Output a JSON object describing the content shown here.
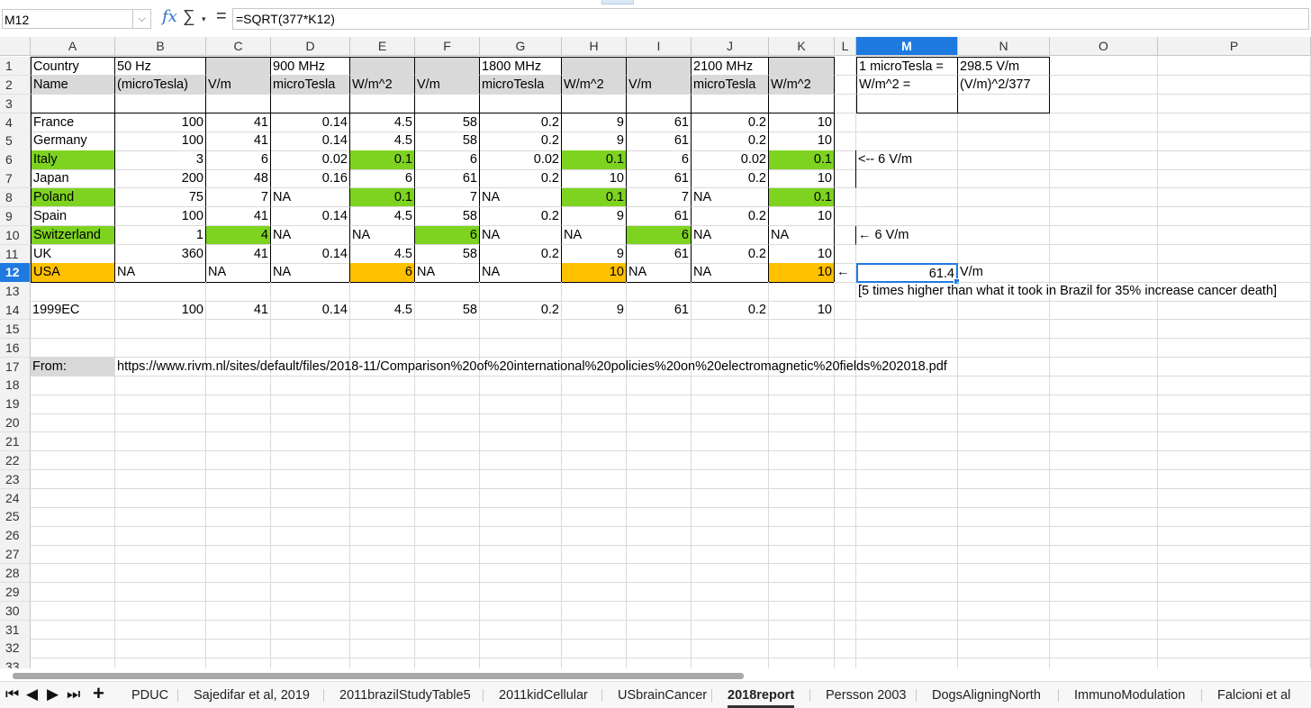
{
  "formula_bar": {
    "name_box": "M12",
    "name_box_dropdown": "⌵",
    "fx_icon": "fx",
    "sigma_icon": "∑",
    "sigma_drop": "▾",
    "equals_icon": "=",
    "formula": "=SQRT(377*K12)"
  },
  "columns": [
    "A",
    "B",
    "C",
    "D",
    "E",
    "F",
    "G",
    "H",
    "I",
    "J",
    "K",
    "L",
    "M",
    "N",
    "O",
    "P"
  ],
  "selected_column": "M",
  "selected_row": "12",
  "rows": [
    "1",
    "2",
    "3",
    "4",
    "5",
    "6",
    "7",
    "8",
    "9",
    "10",
    "11",
    "12",
    "13",
    "14",
    "15",
    "16",
    "17",
    "18",
    "19",
    "20",
    "21",
    "22",
    "23",
    "24",
    "25",
    "26",
    "27",
    "28",
    "29",
    "30",
    "31",
    "32",
    "33"
  ],
  "cells": {
    "A1": "Country",
    "B1": "50 Hz",
    "D1": "900 MHz",
    "G1": "1800 MHz",
    "J1": "2100 MHz",
    "M1": "1 microTesla =",
    "N1": "298.5 V/m",
    "A2": "Name",
    "B2": "(microTesla)",
    "C2": "V/m",
    "D2": "microTesla",
    "E2": "W/m^2",
    "F2": "V/m",
    "G2": "microTesla",
    "H2": "W/m^2",
    "I2": "V/m",
    "J2": "microTesla",
    "K2": "W/m^2",
    "M2": "W/m^2 =",
    "N2": "(V/m)^2/377",
    "A4": "France",
    "B4": "100",
    "C4": "41",
    "D4": "0.14",
    "E4": "4.5",
    "F4": "58",
    "G4": "0.2",
    "H4": "9",
    "I4": "61",
    "J4": "0.2",
    "K4": "10",
    "A5": "Germany",
    "B5": "100",
    "C5": "41",
    "D5": "0.14",
    "E5": "4.5",
    "F5": "58",
    "G5": "0.2",
    "H5": "9",
    "I5": "61",
    "J5": "0.2",
    "K5": "10",
    "A6": "Italy",
    "B6": "3",
    "C6": "6",
    "D6": "0.02",
    "E6": "0.1",
    "F6": "6",
    "G6": "0.02",
    "H6": "0.1",
    "I6": "6",
    "J6": "0.02",
    "K6": "0.1",
    "M6": "<-- 6 V/m",
    "A7": "Japan",
    "B7": "200",
    "C7": "48",
    "D7": "0.16",
    "E7": "6",
    "F7": "61",
    "G7": "0.2",
    "H7": "10",
    "I7": "61",
    "J7": "0.2",
    "K7": "10",
    "A8": "Poland",
    "B8": "75",
    "C8": "7",
    "D8": "NA",
    "E8": "0.1",
    "F8": "7",
    "G8": "NA",
    "H8": "0.1",
    "I8": "7",
    "J8": "NA",
    "K8": "0.1",
    "A9": "Spain",
    "B9": "100",
    "C9": "41",
    "D9": "0.14",
    "E9": "4.5",
    "F9": "58",
    "G9": "0.2",
    "H9": "9",
    "I9": "61",
    "J9": "0.2",
    "K9": "10",
    "A10": "Switzerland",
    "B10": "1",
    "C10": "4",
    "D10": "NA",
    "E10": "NA",
    "F10": "6",
    "G10": "NA",
    "H10": "NA",
    "I10": "6",
    "J10": "NA",
    "K10": "NA",
    "M10": "← 6 V/m",
    "A11": "UK",
    "B11": "360",
    "C11": "41",
    "D11": "0.14",
    "E11": "4.5",
    "F11": "58",
    "G11": "0.2",
    "H11": "9",
    "I11": "61",
    "J11": "0.2",
    "K11": "10",
    "A12": "USA",
    "B12": "NA",
    "C12": "NA",
    "D12": "NA",
    "E12": "6",
    "F12": "NA",
    "G12": "NA",
    "H12": "10",
    "I12": "NA",
    "J12": "NA",
    "K12": "10",
    "L12": "←",
    "M12": "61.4",
    "N12": "V/m",
    "M13": "[5 times higher than what it took in Brazil for 35% increase cancer death]",
    "A14": "1999EC",
    "B14": "100",
    "C14": "41",
    "D14": "0.14",
    "E14": "4.5",
    "F14": "58",
    "G14": "0.2",
    "H14": "9",
    "I14": "61",
    "J14": "0.2",
    "K14": "10",
    "A17": "From:",
    "B17": "https://www.rivm.nl/sites/default/files/2018-11/Comparison%20of%20international%20policies%20on%20electromagnetic%20fields%202018.pdf"
  },
  "sheet_nav": {
    "first": "⏮",
    "prev": "◀",
    "next": "▶",
    "last": "⏭",
    "add": "+"
  },
  "sheet_tabs": [
    "PDUC",
    "Sajedifar et al, 2019",
    "2011brazilStudyTable5",
    "2011kidCellular",
    "USbrainCancer",
    "2018report",
    "Persson 2003",
    "DogsAligningNorth",
    "ImmunoModulation",
    "Falcioni et al"
  ],
  "active_tab": "2018report",
  "colors": {
    "selection": "#1f7ae0",
    "green": "#7ed321",
    "orange": "#ffc000",
    "gray": "#d9d9d9"
  }
}
